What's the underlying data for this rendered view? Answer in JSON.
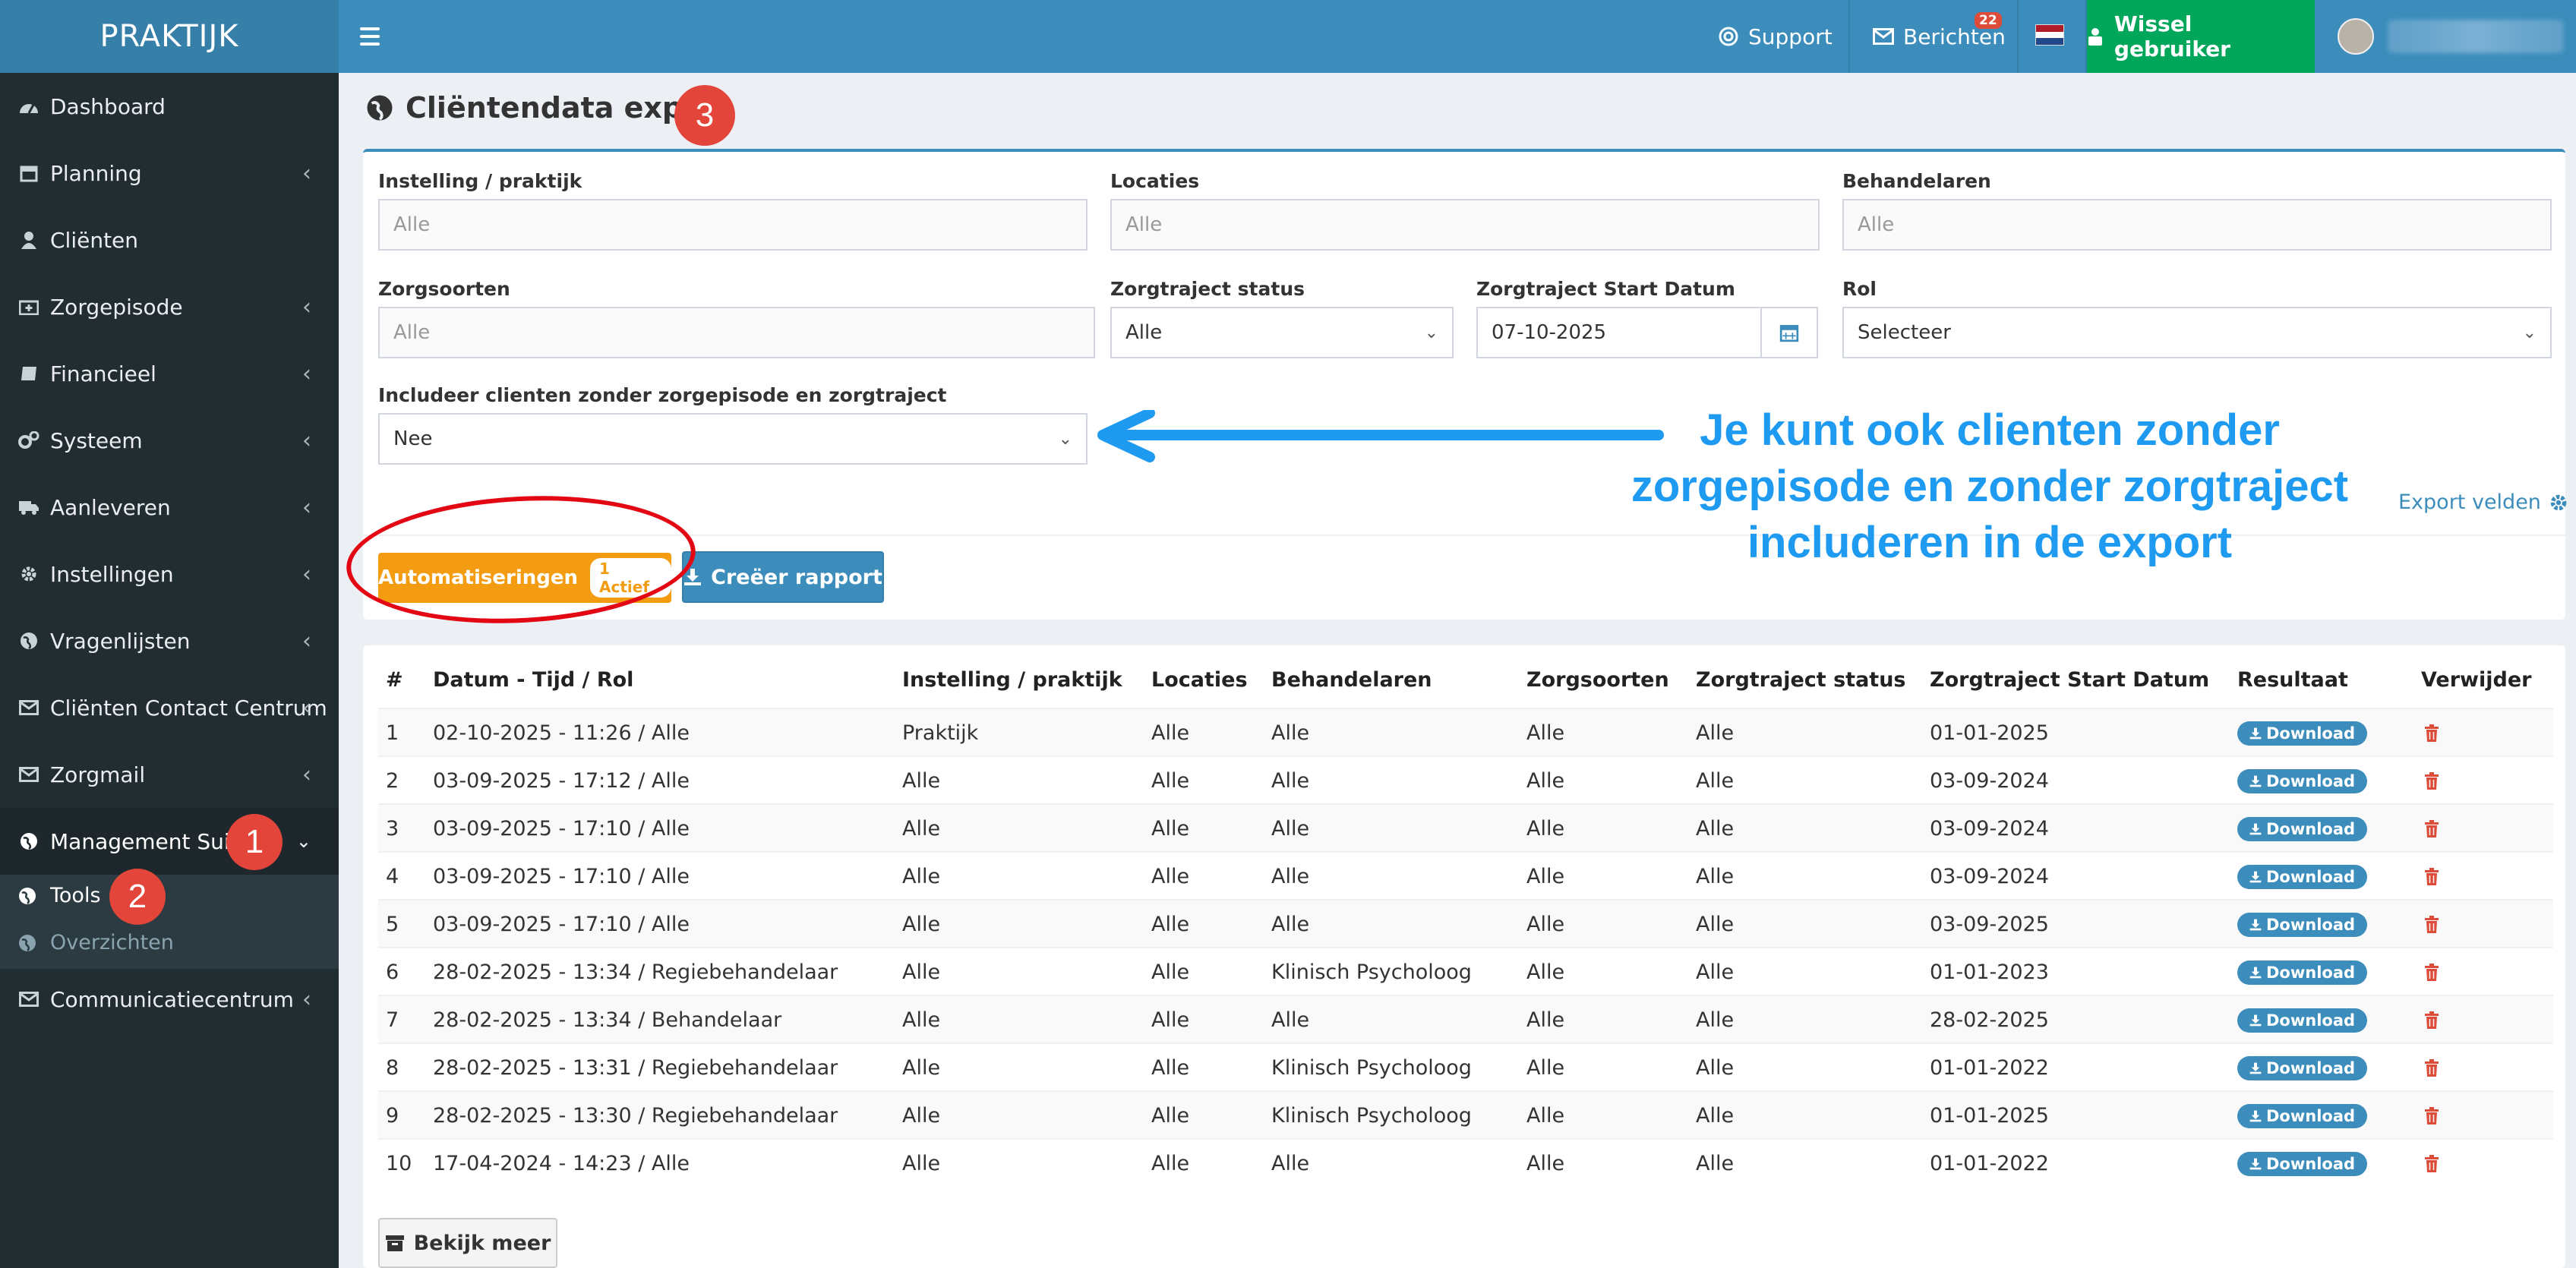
{
  "header": {
    "logo": "PRAKTIJK",
    "support": "Support",
    "messages": "Berichten",
    "messages_count": "22",
    "switch_user": "Wissel gebruiker"
  },
  "sidebar": {
    "items": [
      {
        "label": "Dashboard",
        "icon": "dashboard-icon"
      },
      {
        "label": "Planning",
        "icon": "calendar-icon"
      },
      {
        "label": "Cliënten",
        "icon": "user-icon"
      },
      {
        "label": "Zorgepisode",
        "icon": "medkit-icon"
      },
      {
        "label": "Financieel",
        "icon": "book-icon"
      },
      {
        "label": "Systeem",
        "icon": "cogs-icon"
      },
      {
        "label": "Aanleveren",
        "icon": "truck-icon"
      },
      {
        "label": "Instellingen",
        "icon": "gear-icon"
      },
      {
        "label": "Vragenlijsten",
        "icon": "globe-icon"
      },
      {
        "label": "Cliënten Contact Centrum",
        "icon": "envelope-icon"
      },
      {
        "label": "Zorgmail",
        "icon": "envelope-icon"
      },
      {
        "label": "Management Suite",
        "icon": "globe-icon"
      },
      {
        "label": "Communicatiecentrum",
        "icon": "envelope-icon"
      }
    ],
    "sub_items": [
      "Tools",
      "Overzichten"
    ]
  },
  "step_badges": [
    "1",
    "2",
    "3"
  ],
  "page": {
    "title": "Cliëntendata export"
  },
  "filters": {
    "instelling_label": "Instelling / praktijk",
    "instelling_value": "Alle",
    "locaties_label": "Locaties",
    "locaties_value": "Alle",
    "behandelaren_label": "Behandelaren",
    "behandelaren_value": "Alle",
    "zorgsoorten_label": "Zorgsoorten",
    "zorgsoorten_value": "Alle",
    "status_label": "Zorgtraject status",
    "status_value": "Alle",
    "startdatum_label": "Zorgtraject Start Datum",
    "startdatum_value": "07-10-2025",
    "rol_label": "Rol",
    "rol_value": "Selecteer",
    "include_label": "Includeer clienten zonder zorgepisode en zorgtraject",
    "include_value": "Nee"
  },
  "buttons": {
    "automations": "Automatiseringen",
    "automations_badge": "1 Actief",
    "create_report": "Creëer rapport",
    "export_fields": "Export velden",
    "view_more": "Bekijk meer"
  },
  "annotation": {
    "lines": [
      "Je kunt ook clienten zonder",
      "zorgepisode en zonder zorgtraject",
      "includeren in de export"
    ],
    "color": "#1e9bf0"
  },
  "table": {
    "columns": [
      "#",
      "Datum - Tijd / Rol",
      "Instelling / praktijk",
      "Locaties",
      "Behandelaren",
      "Zorgsoorten",
      "Zorgtraject status",
      "Zorgtraject Start Datum",
      "Resultaat",
      "Verwijder"
    ],
    "download_label": "Download",
    "rows": [
      [
        "1",
        "02-10-2025 - 11:26 / Alle",
        "Praktijk",
        "Alle",
        "Alle",
        "Alle",
        "Alle",
        "01-01-2025"
      ],
      [
        "2",
        "03-09-2025 - 17:12 / Alle",
        "Alle",
        "Alle",
        "Alle",
        "Alle",
        "Alle",
        "03-09-2024"
      ],
      [
        "3",
        "03-09-2025 - 17:10 / Alle",
        "Alle",
        "Alle",
        "Alle",
        "Alle",
        "Alle",
        "03-09-2024"
      ],
      [
        "4",
        "03-09-2025 - 17:10 / Alle",
        "Alle",
        "Alle",
        "Alle",
        "Alle",
        "Alle",
        "03-09-2024"
      ],
      [
        "5",
        "03-09-2025 - 17:10 / Alle",
        "Alle",
        "Alle",
        "Alle",
        "Alle",
        "Alle",
        "03-09-2025"
      ],
      [
        "6",
        "28-02-2025 - 13:34 / Regiebehandelaar",
        "Alle",
        "Alle",
        "Klinisch Psycholoog",
        "Alle",
        "Alle",
        "01-01-2023"
      ],
      [
        "7",
        "28-02-2025 - 13:34 / Behandelaar",
        "Alle",
        "Alle",
        "Alle",
        "Alle",
        "Alle",
        "28-02-2025"
      ],
      [
        "8",
        "28-02-2025 - 13:31 / Regiebehandelaar",
        "Alle",
        "Alle",
        "Klinisch Psycholoog",
        "Alle",
        "Alle",
        "01-01-2022"
      ],
      [
        "9",
        "28-02-2025 - 13:30 / Regiebehandelaar",
        "Alle",
        "Alle",
        "Klinisch Psycholoog",
        "Alle",
        "Alle",
        "01-01-2025"
      ],
      [
        "10",
        "17-04-2024 - 14:23 / Alle",
        "Alle",
        "Alle",
        "Alle",
        "Alle",
        "Alle",
        "01-01-2022"
      ]
    ]
  },
  "colors": {
    "header": "#3c8dbc",
    "sidebar": "#222d32",
    "accent_green": "#00a65a",
    "accent_orange": "#f39c12",
    "danger": "#dd4b39"
  }
}
